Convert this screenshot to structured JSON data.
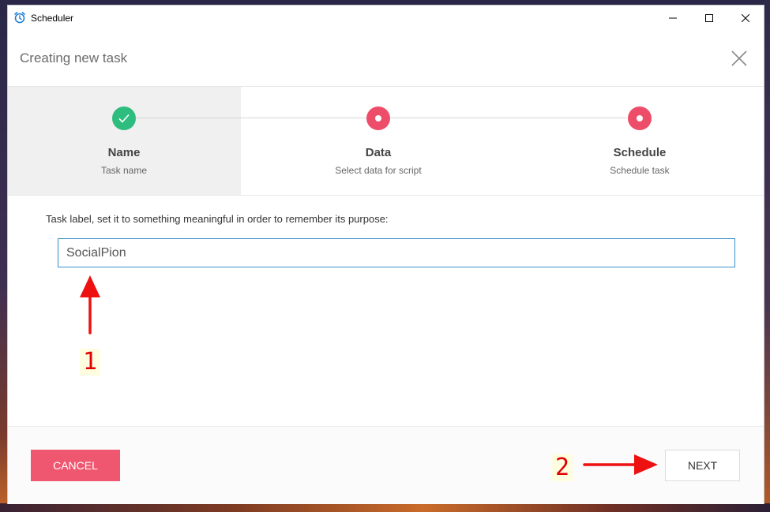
{
  "window": {
    "app_title": "Scheduler",
    "controls": {
      "minimize": "minimize-icon",
      "maximize": "maximize-icon",
      "close": "close-icon"
    }
  },
  "dialog": {
    "title": "Creating new task"
  },
  "steps": [
    {
      "name": "Name",
      "description": "Task name",
      "state": "done"
    },
    {
      "name": "Data",
      "description": "Select data for script",
      "state": "todo"
    },
    {
      "name": "Schedule",
      "description": "Schedule task",
      "state": "todo"
    }
  ],
  "form": {
    "label": "Task label, set it to something meaningful in order to remember its purpose:",
    "task_label_value": "SocialPion"
  },
  "footer": {
    "cancel_label": "CANCEL",
    "next_label": "NEXT"
  },
  "annotations": {
    "marker_1": "1",
    "marker_2": "2"
  },
  "colors": {
    "accent_pink": "#ee4d6a",
    "done_green": "#2ebd7e",
    "input_border": "#3d8ec9",
    "annotation_red": "#e00000"
  }
}
